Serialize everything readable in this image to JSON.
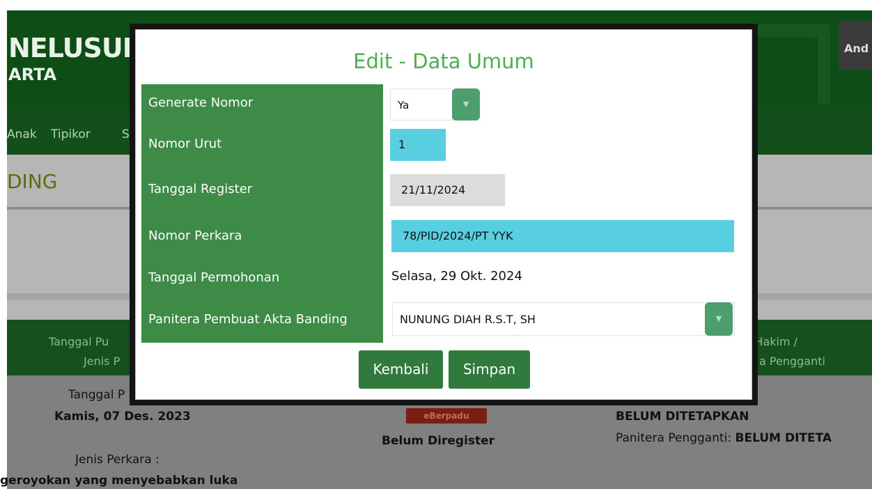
{
  "background": {
    "app_title": "NELUSURA",
    "app_subtitle": "ARTA",
    "user_button_label": "And",
    "nav_items": [
      "Anak",
      "Tipikor",
      "SP"
    ],
    "section_title": "DING",
    "table_headers": {
      "col1_line1": "Tanggal Pu",
      "col1_line2": "Jenis P",
      "col3_line1": "s Hakim /",
      "col3_line2": "a Pengganti"
    },
    "row": {
      "tanggal_label": "Tanggal P",
      "tanggal_value": "Kamis, 07 Des. 2023",
      "jenis_label": "Jenis Perkara :",
      "jenis_value": "geroyokan yang menyebabkan luka",
      "badge": "eBerpadu",
      "status": "Belum Diregister",
      "hakim_value": "BELUM DITETAPKAN",
      "panitera_label": "Panitera Pengganti:",
      "panitera_value": "BELUM DITETA"
    }
  },
  "modal": {
    "title": "Edit - Data Umum",
    "fields": {
      "generate_nomor": {
        "label": "Generate Nomor",
        "value": "Ya"
      },
      "nomor_urut": {
        "label": "Nomor Urut",
        "value": "1"
      },
      "tanggal_register": {
        "label": "Tanggal Register",
        "value": "21/11/2024"
      },
      "nomor_perkara": {
        "label": "Nomor Perkara",
        "value": "78/PID/2024/PT YYK"
      },
      "tanggal_permohonan": {
        "label": "Tanggal Permohonan",
        "value": "Selasa, 29 Okt. 2024"
      },
      "panitera": {
        "label": "Panitera Pembuat Akta Banding",
        "value": "NUNUNG DIAH R.S.T, SH"
      }
    },
    "buttons": {
      "back": "Kembali",
      "save": "Simpan"
    },
    "dropdown_arrow": "▼"
  },
  "colors": {
    "label_bg": "#3d8b47",
    "input_cyan": "#58cfe0",
    "title_green": "#4caf50",
    "button_green": "#2f7a3c"
  }
}
